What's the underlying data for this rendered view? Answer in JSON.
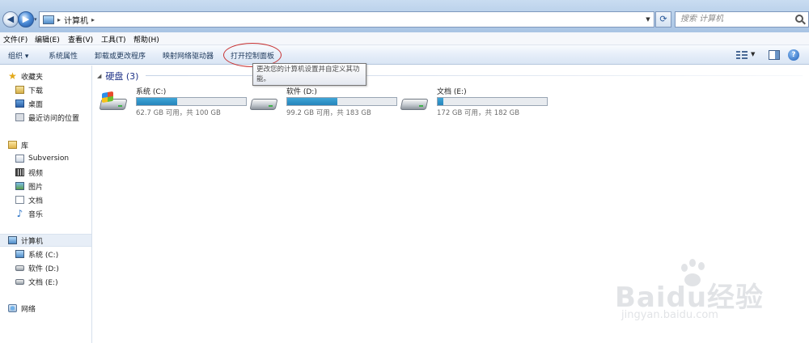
{
  "address": {
    "path": "计算机",
    "search_placeholder": "搜索 计算机"
  },
  "menu": [
    "文件(F)",
    "编辑(E)",
    "查看(V)",
    "工具(T)",
    "帮助(H)"
  ],
  "commands": {
    "organize": "组织 ▾",
    "system_properties": "系统属性",
    "uninstall": "卸载或更改程序",
    "map_drive": "映射网络驱动器",
    "control_panel": "打开控制面板"
  },
  "tooltip": "更改您的计算机设置并自定义其功能。",
  "sidebar": {
    "favorites": {
      "label": "收藏夹",
      "items": [
        "下载",
        "桌面",
        "最近访问的位置"
      ]
    },
    "libraries": {
      "label": "库",
      "items": [
        "Subversion",
        "视频",
        "图片",
        "文档",
        "音乐"
      ]
    },
    "computer": {
      "label": "计算机",
      "items": [
        "系统 (C:)",
        "软件 (D:)",
        "文档 (E:)"
      ]
    },
    "network": {
      "label": "网络"
    }
  },
  "main": {
    "group_title": "硬盘 (3)",
    "drives": [
      {
        "name": "系统 (C:)",
        "free_text": "62.7 GB 可用，共 100 GB",
        "used_fraction": 0.373,
        "icon": "system-drive-icon"
      },
      {
        "name": "软件 (D:)",
        "free_text": "99.2 GB 可用，共 183 GB",
        "used_fraction": 0.458,
        "icon": "drive-icon"
      },
      {
        "name": "文档 (E:)",
        "free_text": "172 GB 可用，共 182 GB",
        "used_fraction": 0.055,
        "icon": "drive-icon"
      }
    ]
  },
  "watermark": {
    "brand": "Baidu经验",
    "url": "jingyan.baidu.com"
  }
}
